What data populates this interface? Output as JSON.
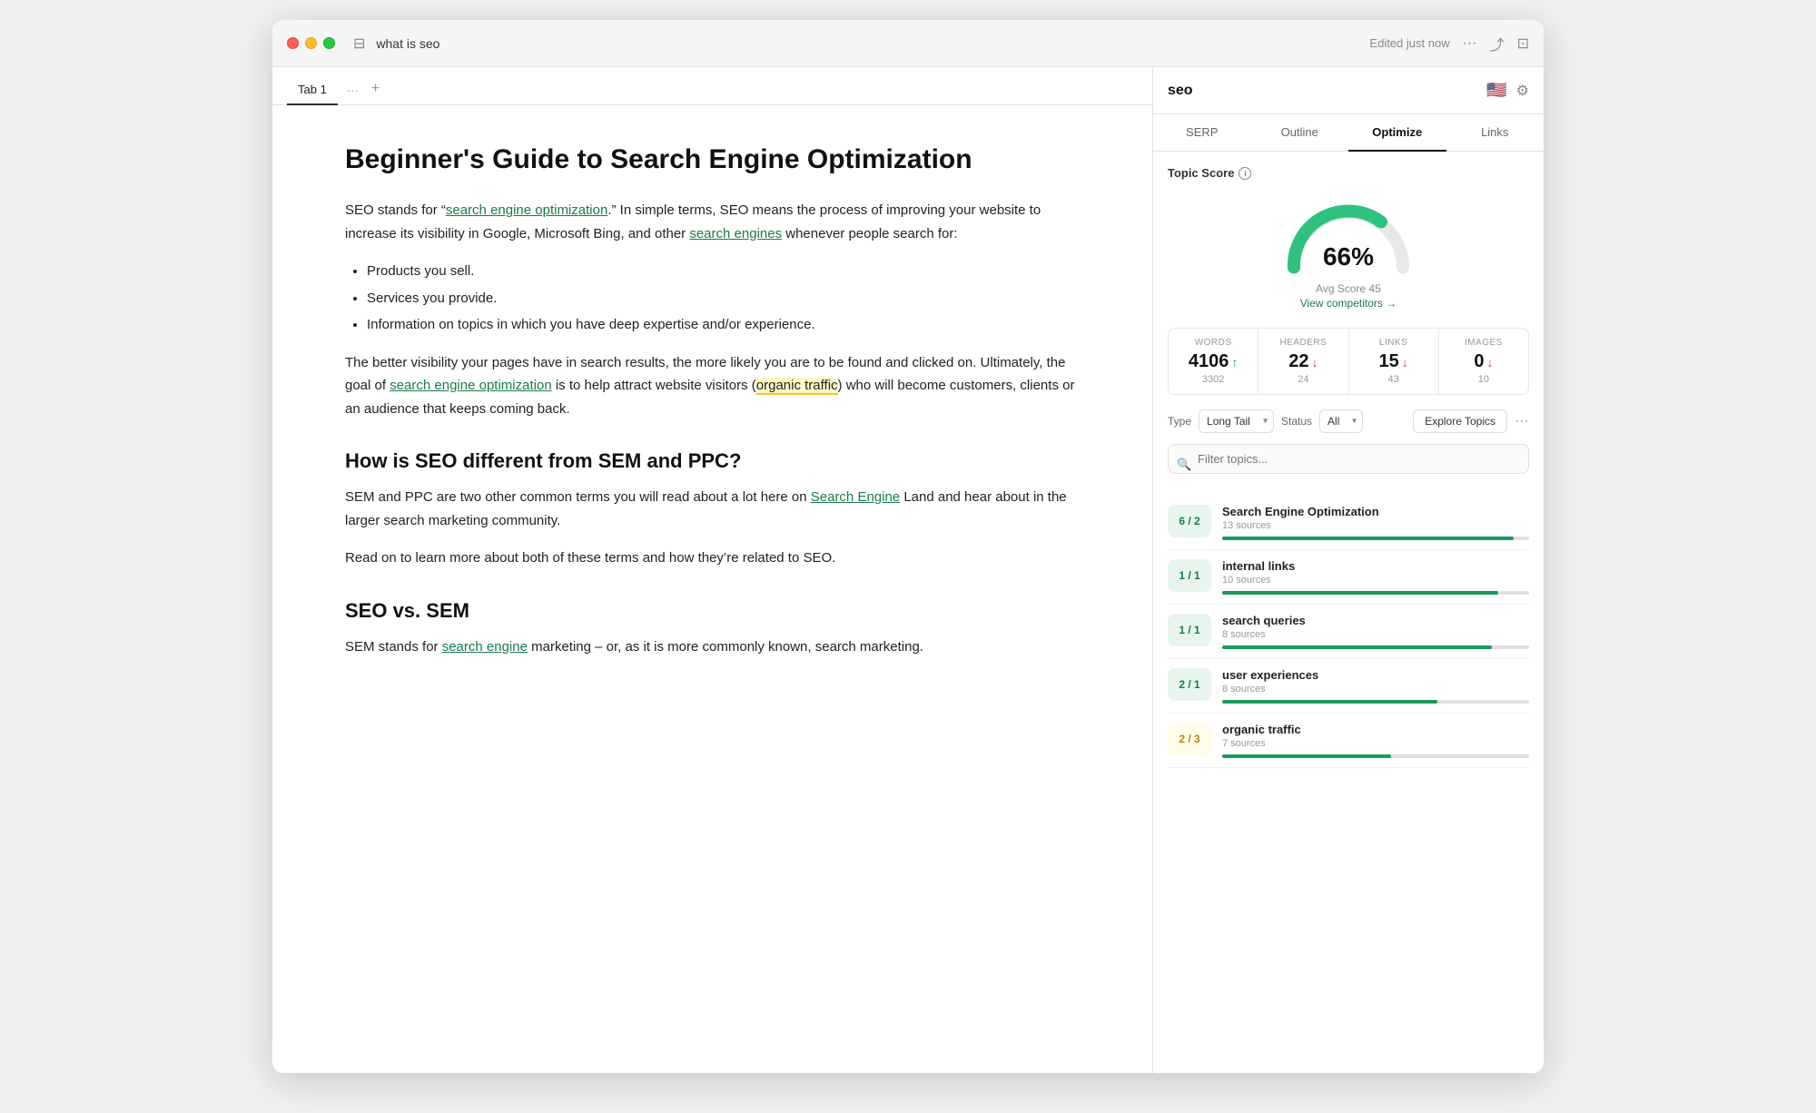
{
  "window": {
    "title": "what is seo"
  },
  "titlebar": {
    "sidebar_toggle": "☰",
    "doc_title": "what is seo",
    "edited_text": "Edited just now",
    "more_icon": "···",
    "share_icon": "⤴",
    "layout_icon": "⊡"
  },
  "tabs": [
    {
      "label": "Tab 1",
      "active": true
    },
    {
      "label": "···",
      "active": false
    },
    {
      "label": "+",
      "active": false
    }
  ],
  "editor": {
    "h1": "Beginner's Guide to Search Engine Optimization",
    "p1_before": "SEO stands for “",
    "p1_link1": "search engine optimization",
    "p1_after": ".” In simple terms, SEO means the process of improving your website to increase its visibility in Google, Microsoft Bing, and other ",
    "p1_link2": "search engines",
    "p1_end": " whenever people search for:",
    "bullets": [
      "Products you sell.",
      "Services you provide.",
      "Information on topics in which you have deep expertise and/or experience."
    ],
    "p2": "The better visibility your pages have in search results, the more likely you are to be found and clicked on. Ultimately, the goal of ",
    "p2_link": "search engine optimization",
    "p2_after": " is to help attract website visitors (",
    "p2_highlight": "organic traffic",
    "p2_end": ") who will become customers, clients or an audience that keeps coming back.",
    "h2_1": "How is SEO different from SEM and PPC?",
    "p3": "SEM and PPC are two other common terms you will read about a lot here on ",
    "p3_link": "Search Engine",
    "p3_after": " Land and hear about in the larger search marketing community.",
    "p4": "Read on to learn more about both of these terms and how they’re related to SEO.",
    "h2_2": "SEO vs. SEM",
    "p5": "SEM stands for ",
    "p5_link": "search engine",
    "p5_after": " marketing – or, as it is more commonly known, search marketing."
  },
  "right_panel": {
    "search_term": "seo",
    "tabs": [
      "SERP",
      "Outline",
      "Optimize",
      "Links"
    ],
    "active_tab": "Optimize",
    "topic_score": {
      "label": "Topic Score",
      "percentage": "66%",
      "avg_score_label": "Avg Score 45",
      "view_competitors": "View competitors →"
    },
    "stats": [
      {
        "label": "WORDS",
        "value": "4106",
        "arrow": "up",
        "sub": "3302"
      },
      {
        "label": "HEADERS",
        "value": "22",
        "arrow": "down",
        "sub": "24"
      },
      {
        "label": "LINKS",
        "value": "15",
        "arrow": "down",
        "sub": "43"
      },
      {
        "label": "IMAGES",
        "value": "0",
        "arrow": "down",
        "sub": "10"
      }
    ],
    "type_label": "Type",
    "status_label": "Status",
    "type_value": "Long Tail",
    "status_value": "All",
    "explore_btn": "Explore Topics",
    "filter_placeholder": "Filter topics...",
    "topics": [
      {
        "score": "6 / 2",
        "name": "Search Engine Optimization",
        "sources": "13 sources",
        "bar_pct": 95,
        "type": "full"
      },
      {
        "score": "1 / 1",
        "name": "internal links",
        "sources": "10 sources",
        "bar_pct": 90,
        "type": "full"
      },
      {
        "score": "1 / 1",
        "name": "search queries",
        "sources": "8 sources",
        "bar_pct": 88,
        "type": "full"
      },
      {
        "score": "2 / 1",
        "name": "user experiences",
        "sources": "8 sources",
        "bar_pct": 70,
        "type": "full"
      },
      {
        "score": "2 / 3",
        "name": "organic traffic",
        "sources": "7 sources",
        "bar_pct": 55,
        "type": "partial"
      }
    ]
  }
}
